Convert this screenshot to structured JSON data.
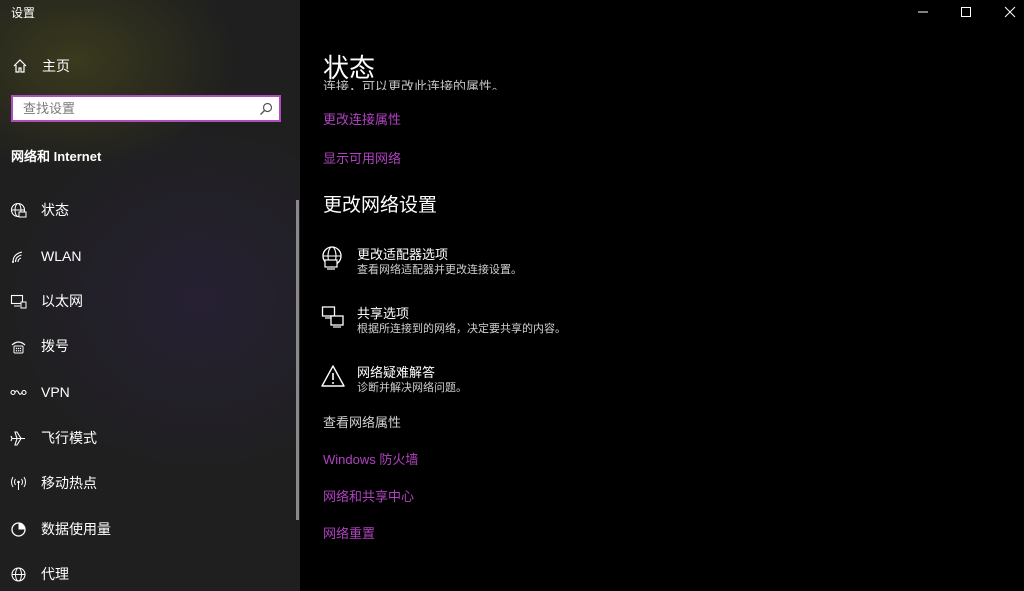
{
  "window": {
    "title": "设置"
  },
  "sidebar": {
    "home_label": "主页",
    "search_placeholder": "查找设置",
    "section_title": "网络和 Internet",
    "items": [
      {
        "label": "状态",
        "icon": "globe-status-icon"
      },
      {
        "label": "WLAN",
        "icon": "wifi-icon"
      },
      {
        "label": "以太网",
        "icon": "ethernet-icon"
      },
      {
        "label": "拨号",
        "icon": "dialup-icon"
      },
      {
        "label": "VPN",
        "icon": "vpn-icon"
      },
      {
        "label": "飞行模式",
        "icon": "airplane-icon"
      },
      {
        "label": "移动热点",
        "icon": "hotspot-icon"
      },
      {
        "label": "数据使用量",
        "icon": "data-usage-icon"
      },
      {
        "label": "代理",
        "icon": "globe-icon"
      }
    ]
  },
  "main": {
    "title": "状态",
    "clipped_text": "连接，可以更改此连接的属性。",
    "top_links": [
      "更改连接属性",
      "显示可用网络"
    ],
    "section_heading": "更改网络设置",
    "options": [
      {
        "title": "更改适配器选项",
        "desc": "查看网络适配器并更改连接设置。",
        "icon": "adapter-icon"
      },
      {
        "title": "共享选项",
        "desc": "根据所连接到的网络，决定要共享的内容。",
        "icon": "sharing-icon"
      },
      {
        "title": "网络疑难解答",
        "desc": "诊断并解决网络问题。",
        "icon": "warning-icon"
      }
    ],
    "view_properties": "查看网络属性",
    "bottom_links": [
      "Windows 防火墙",
      "网络和共享中心",
      "网络重置"
    ]
  },
  "colors": {
    "accent": "#b042c0",
    "sidebar_bg": "#1f1f1f",
    "main_bg": "#000000"
  }
}
